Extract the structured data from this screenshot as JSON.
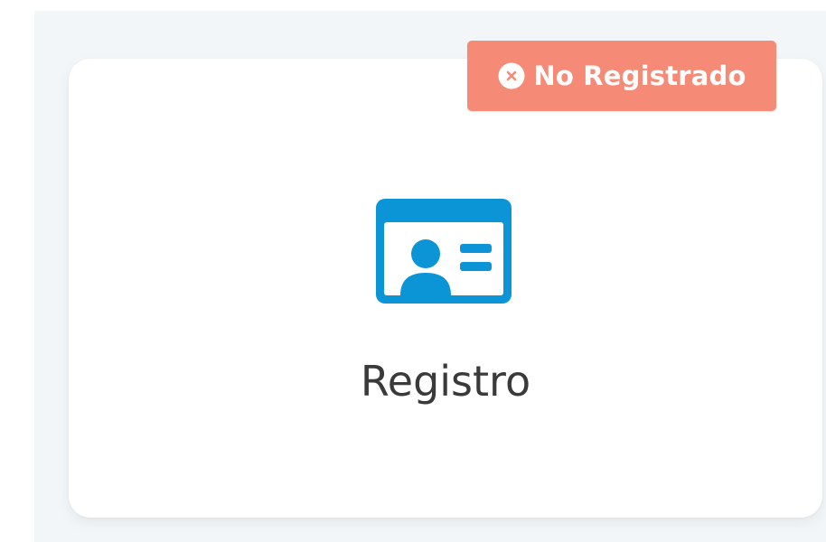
{
  "status_badge": {
    "icon": "close-circle-icon",
    "label": "No Registrado",
    "color": "#f58b76"
  },
  "card": {
    "icon": "id-card-icon",
    "label": "Registro",
    "icon_color": "#0c95d6"
  }
}
